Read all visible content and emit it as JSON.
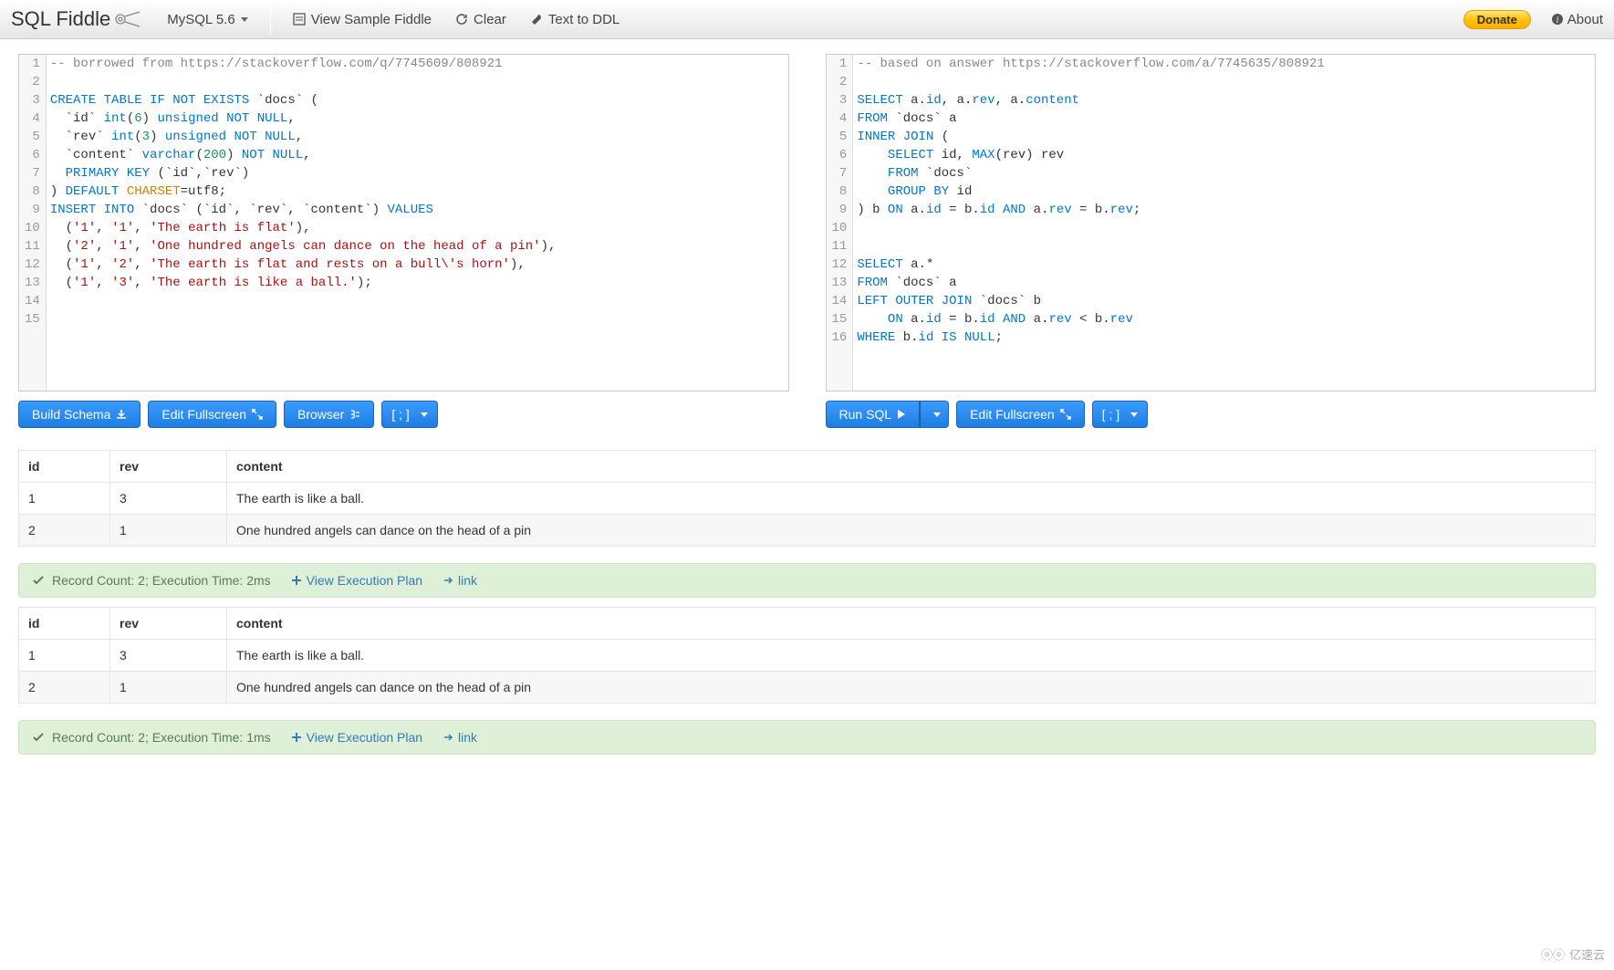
{
  "toolbar": {
    "brand": "SQL Fiddle",
    "database": "MySQL 5.6",
    "view_sample": "View Sample Fiddle",
    "clear": "Clear",
    "text_to_ddl": "Text to DDL",
    "donate": "Donate",
    "about": "About"
  },
  "schema_editor": {
    "line_count": 15,
    "lines": [
      {
        "t": "comment",
        "text": "-- borrowed from https://stackoverflow.com/q/7745609/808921"
      },
      {
        "t": "blank"
      },
      {
        "t": "tokens",
        "tok": [
          [
            "kw",
            "CREATE"
          ],
          [
            "sp",
            " "
          ],
          [
            "kw",
            "TABLE"
          ],
          [
            "sp",
            " "
          ],
          [
            "kw",
            "IF"
          ],
          [
            "sp",
            " "
          ],
          [
            "kw",
            "NOT"
          ],
          [
            "sp",
            " "
          ],
          [
            "kw",
            "EXISTS"
          ],
          [
            "sp",
            " `docs` ("
          ]
        ]
      },
      {
        "t": "tokens",
        "tok": [
          [
            "sp",
            "  `id` "
          ],
          [
            "kw",
            "int"
          ],
          [
            "txt",
            "("
          ],
          [
            "num",
            "6"
          ],
          [
            "txt",
            ") "
          ],
          [
            "kw",
            "unsigned"
          ],
          [
            "sp",
            " "
          ],
          [
            "kw",
            "NOT"
          ],
          [
            "sp",
            " "
          ],
          [
            "kw",
            "NULL"
          ],
          [
            "txt",
            ","
          ]
        ]
      },
      {
        "t": "tokens",
        "tok": [
          [
            "sp",
            "  `rev` "
          ],
          [
            "kw",
            "int"
          ],
          [
            "txt",
            "("
          ],
          [
            "num",
            "3"
          ],
          [
            "txt",
            ") "
          ],
          [
            "kw",
            "unsigned"
          ],
          [
            "sp",
            " "
          ],
          [
            "kw",
            "NOT"
          ],
          [
            "sp",
            " "
          ],
          [
            "kw",
            "NULL"
          ],
          [
            "txt",
            ","
          ]
        ]
      },
      {
        "t": "tokens",
        "tok": [
          [
            "sp",
            "  `content` "
          ],
          [
            "kw",
            "varchar"
          ],
          [
            "txt",
            "("
          ],
          [
            "num",
            "200"
          ],
          [
            "txt",
            ") "
          ],
          [
            "kw",
            "NOT"
          ],
          [
            "sp",
            " "
          ],
          [
            "kw",
            "NULL"
          ],
          [
            "txt",
            ","
          ]
        ]
      },
      {
        "t": "tokens",
        "tok": [
          [
            "sp",
            "  "
          ],
          [
            "kw",
            "PRIMARY"
          ],
          [
            "sp",
            " "
          ],
          [
            "kw",
            "KEY"
          ],
          [
            "sp",
            " (`id`,`rev`)"
          ]
        ]
      },
      {
        "t": "tokens",
        "tok": [
          [
            "txt",
            ") "
          ],
          [
            "kw",
            "DEFAULT"
          ],
          [
            "sp",
            " "
          ],
          [
            "fn",
            "CHARSET"
          ],
          [
            "txt",
            "=utf8;"
          ]
        ]
      },
      {
        "t": "tokens",
        "tok": [
          [
            "kw",
            "INSERT"
          ],
          [
            "sp",
            " "
          ],
          [
            "kw",
            "INTO"
          ],
          [
            "sp",
            " `docs` (`id`, `rev`, `content`) "
          ],
          [
            "kw",
            "VALUES"
          ]
        ]
      },
      {
        "t": "tokens",
        "tok": [
          [
            "sp",
            "  ("
          ],
          [
            "str",
            "'1'"
          ],
          [
            "txt",
            ", "
          ],
          [
            "str",
            "'1'"
          ],
          [
            "txt",
            ", "
          ],
          [
            "str",
            "'The earth is flat'"
          ],
          [
            "txt",
            "),"
          ]
        ]
      },
      {
        "t": "tokens",
        "tok": [
          [
            "sp",
            "  ("
          ],
          [
            "str",
            "'2'"
          ],
          [
            "txt",
            ", "
          ],
          [
            "str",
            "'1'"
          ],
          [
            "txt",
            ", "
          ],
          [
            "str",
            "'One hundred angels can dance on the head of a pin'"
          ],
          [
            "txt",
            "),"
          ]
        ]
      },
      {
        "t": "tokens",
        "tok": [
          [
            "sp",
            "  ("
          ],
          [
            "str",
            "'1'"
          ],
          [
            "txt",
            ", "
          ],
          [
            "str",
            "'2'"
          ],
          [
            "txt",
            ", "
          ],
          [
            "str",
            "'The earth is flat and rests on a bull\\'s horn'"
          ],
          [
            "txt",
            "),"
          ]
        ]
      },
      {
        "t": "tokens",
        "tok": [
          [
            "sp",
            "  ("
          ],
          [
            "str",
            "'1'"
          ],
          [
            "txt",
            ", "
          ],
          [
            "str",
            "'3'"
          ],
          [
            "txt",
            ", "
          ],
          [
            "str",
            "'The earth is like a ball.'"
          ],
          [
            "txt",
            ");"
          ]
        ]
      },
      {
        "t": "blank"
      },
      {
        "t": "blank"
      }
    ],
    "buttons": {
      "build_schema": "Build Schema",
      "edit_fullscreen": "Edit Fullscreen",
      "browser": "Browser",
      "terminator": "[ ; ]"
    }
  },
  "query_editor": {
    "line_count": 16,
    "lines": [
      {
        "t": "comment",
        "text": "-- based on answer https://stackoverflow.com/a/7745635/808921"
      },
      {
        "t": "blank"
      },
      {
        "t": "tokens",
        "tok": [
          [
            "kw",
            "SELECT"
          ],
          [
            "sp",
            " a."
          ],
          [
            "kw",
            "id"
          ],
          [
            "txt",
            ", a."
          ],
          [
            "kw",
            "rev"
          ],
          [
            "txt",
            ", a."
          ],
          [
            "kw",
            "content"
          ]
        ]
      },
      {
        "t": "tokens",
        "tok": [
          [
            "kw",
            "FROM"
          ],
          [
            "sp",
            " `docs` a"
          ]
        ]
      },
      {
        "t": "tokens",
        "tok": [
          [
            "kw",
            "INNER"
          ],
          [
            "sp",
            " "
          ],
          [
            "kw",
            "JOIN"
          ],
          [
            "sp",
            " ("
          ]
        ]
      },
      {
        "t": "tokens",
        "tok": [
          [
            "sp",
            "    "
          ],
          [
            "kw",
            "SELECT"
          ],
          [
            "sp",
            " id, "
          ],
          [
            "kw",
            "MAX"
          ],
          [
            "txt",
            "(rev) rev"
          ]
        ]
      },
      {
        "t": "tokens",
        "tok": [
          [
            "sp",
            "    "
          ],
          [
            "kw",
            "FROM"
          ],
          [
            "sp",
            " `docs`"
          ]
        ]
      },
      {
        "t": "tokens",
        "tok": [
          [
            "sp",
            "    "
          ],
          [
            "kw",
            "GROUP"
          ],
          [
            "sp",
            " "
          ],
          [
            "kw",
            "BY"
          ],
          [
            "sp",
            " id"
          ]
        ]
      },
      {
        "t": "tokens",
        "tok": [
          [
            "txt",
            ") b "
          ],
          [
            "kw",
            "ON"
          ],
          [
            "sp",
            " a."
          ],
          [
            "kw",
            "id"
          ],
          [
            "txt",
            " = b."
          ],
          [
            "kw",
            "id"
          ],
          [
            "sp",
            " "
          ],
          [
            "kw",
            "AND"
          ],
          [
            "sp",
            " a."
          ],
          [
            "kw",
            "rev"
          ],
          [
            "txt",
            " = b."
          ],
          [
            "kw",
            "rev"
          ],
          [
            "txt",
            ";"
          ]
        ]
      },
      {
        "t": "blank"
      },
      {
        "t": "blank"
      },
      {
        "t": "tokens",
        "tok": [
          [
            "kw",
            "SELECT"
          ],
          [
            "sp",
            " a.*"
          ]
        ]
      },
      {
        "t": "tokens",
        "tok": [
          [
            "kw",
            "FROM"
          ],
          [
            "sp",
            " `docs` a"
          ]
        ]
      },
      {
        "t": "tokens",
        "tok": [
          [
            "kw",
            "LEFT"
          ],
          [
            "sp",
            " "
          ],
          [
            "kw",
            "OUTER"
          ],
          [
            "sp",
            " "
          ],
          [
            "kw",
            "JOIN"
          ],
          [
            "sp",
            " `docs` b"
          ]
        ]
      },
      {
        "t": "tokens",
        "tok": [
          [
            "sp",
            "    "
          ],
          [
            "kw",
            "ON"
          ],
          [
            "sp",
            " a."
          ],
          [
            "kw",
            "id"
          ],
          [
            "txt",
            " = b."
          ],
          [
            "kw",
            "id"
          ],
          [
            "sp",
            " "
          ],
          [
            "kw",
            "AND"
          ],
          [
            "sp",
            " a."
          ],
          [
            "kw",
            "rev"
          ],
          [
            "txt",
            " < b."
          ],
          [
            "kw",
            "rev"
          ]
        ]
      },
      {
        "t": "tokens",
        "tok": [
          [
            "kw",
            "WHERE"
          ],
          [
            "sp",
            " b."
          ],
          [
            "kw",
            "id"
          ],
          [
            "sp",
            " "
          ],
          [
            "kw",
            "IS"
          ],
          [
            "sp",
            " "
          ],
          [
            "kw",
            "NULL"
          ],
          [
            "txt",
            ";"
          ]
        ]
      }
    ],
    "buttons": {
      "run_sql": "Run SQL",
      "edit_fullscreen": "Edit Fullscreen",
      "terminator": "[ ; ]"
    }
  },
  "results": [
    {
      "columns": [
        "id",
        "rev",
        "content"
      ],
      "rows": [
        [
          "1",
          "3",
          "The earth is like a ball."
        ],
        [
          "2",
          "1",
          "One hundred angels can dance on the head of a pin"
        ]
      ],
      "status": "Record Count: 2; Execution Time: 2ms",
      "plan_link": "View Execution Plan",
      "link": "link"
    },
    {
      "columns": [
        "id",
        "rev",
        "content"
      ],
      "rows": [
        [
          "1",
          "3",
          "The earth is like a ball."
        ],
        [
          "2",
          "1",
          "One hundred angels can dance on the head of a pin"
        ]
      ],
      "status": "Record Count: 2; Execution Time: 1ms",
      "plan_link": "View Execution Plan",
      "link": "link"
    }
  ],
  "watermark": "亿速云"
}
